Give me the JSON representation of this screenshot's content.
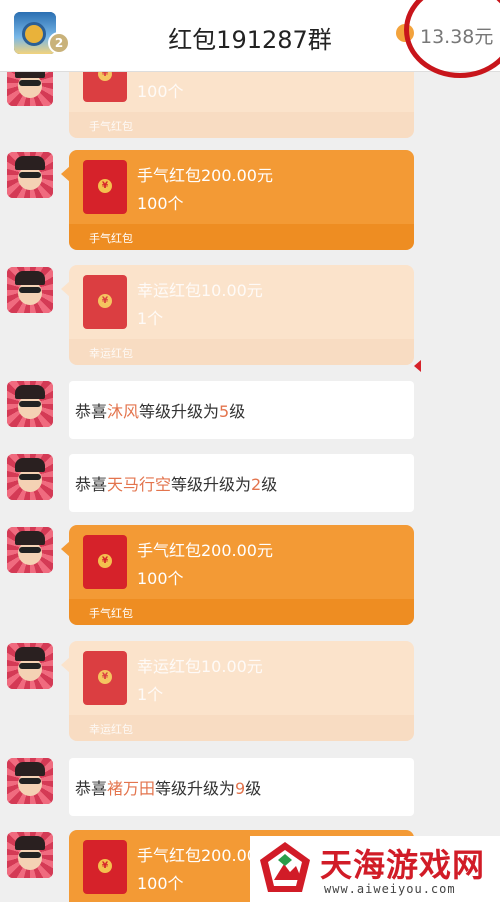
{
  "header": {
    "title": "红包191287群",
    "level": "2",
    "balance": "13.38元",
    "icons": {
      "avatar": "group-avatar-icon",
      "coin": "coin-icon"
    }
  },
  "messages": [
    {
      "kind": "redpacket",
      "state": "opened",
      "title": "",
      "count": "100个",
      "type": "手气红包"
    },
    {
      "kind": "redpacket",
      "state": "active",
      "title": "手气红包200.00元",
      "count": "100个",
      "type": "手气红包"
    },
    {
      "kind": "redpacket",
      "state": "opened",
      "title": "幸运红包10.00元",
      "count": "1个",
      "type": "幸运红包"
    },
    {
      "kind": "system",
      "prefix": "恭喜",
      "name": "沐风",
      "suffix": "等级升级为",
      "level": "5",
      "unit": "级"
    },
    {
      "kind": "system",
      "prefix": "恭喜",
      "name": "天马行空",
      "suffix": "等级升级为",
      "level": "2",
      "unit": "级"
    },
    {
      "kind": "redpacket",
      "state": "active",
      "title": "手气红包200.00元",
      "count": "100个",
      "type": "手气红包"
    },
    {
      "kind": "redpacket",
      "state": "opened",
      "title": "幸运红包10.00元",
      "count": "1个",
      "type": "幸运红包"
    },
    {
      "kind": "system",
      "prefix": "恭喜",
      "name": "褚万田",
      "suffix": "等级升级为",
      "level": "9",
      "unit": "级"
    },
    {
      "kind": "redpacket",
      "state": "active",
      "title": "手气红包200.00",
      "count": "100个",
      "type": ""
    }
  ],
  "watermark": {
    "name": "天海游戏网",
    "url": "www.aiweiyou.com"
  },
  "colors": {
    "active_packet": "#f39a35",
    "opened_packet": "#fbe3cb",
    "highlight_name": "#e3744d",
    "annotation": "#c8151b",
    "brand": "#d11c27"
  }
}
